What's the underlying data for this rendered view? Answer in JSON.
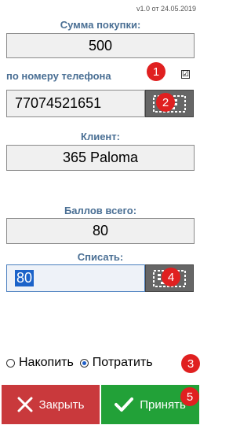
{
  "version": "v1.0 от 24.05.2019",
  "purchase": {
    "label": "Сумма покупки:",
    "value": "500"
  },
  "phone": {
    "label": "по номеру телефона",
    "checked_mark": "☑",
    "value": "77074521651"
  },
  "client": {
    "label": "Клиент:",
    "value": "365 Paloma"
  },
  "points": {
    "label": "Баллов всего:",
    "value": "80"
  },
  "writeoff": {
    "label": "Списать:",
    "value": "80"
  },
  "options": {
    "accumulate": "Накопить",
    "spend": "Потратить",
    "selected": "spend"
  },
  "buttons": {
    "close": "Закрыть",
    "accept": "Принять"
  },
  "badges": [
    "1",
    "2",
    "3",
    "4",
    "5"
  ],
  "colors": {
    "label": "#4a6f94",
    "close": "#c9393c",
    "accept": "#22a138",
    "badge": "#e02020",
    "selection": "#1c63c9"
  },
  "icons": {
    "keyboard": "keyboard-icon",
    "close": "x-icon",
    "accept": "checkmark-icon"
  }
}
